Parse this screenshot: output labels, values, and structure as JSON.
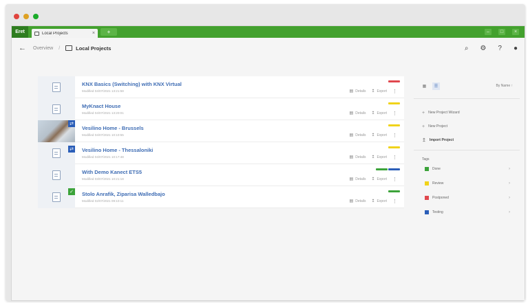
{
  "window": {
    "traffic_lights": [
      "#e0443e",
      "#dea123",
      "#1aab29"
    ]
  },
  "titlebar": {
    "brand": "Eret",
    "tab_label": "Local Projects",
    "tab_close": "×",
    "new_tab": "+",
    "controls": [
      "–",
      "□",
      "×"
    ]
  },
  "navbar": {
    "back": "←",
    "crumb_overview": "Overview",
    "crumb_sep": "/",
    "current": "Local Projects",
    "actions": [
      "⌕",
      "⚙",
      "?",
      "●"
    ]
  },
  "projects": [
    {
      "name": "KNX Basics (Switching) with KNX Virtual",
      "modified": "Modified 04/07/2021 13:21:58",
      "detail": "Details",
      "export": "Export",
      "tags": [
        "#e0484e"
      ],
      "thumb": "doc",
      "badge": null
    },
    {
      "name": "MyKnact House",
      "modified": "Modified 04/07/2021 13:20:01",
      "detail": "Details",
      "export": "Export",
      "tags": [
        "#f0d31a"
      ],
      "thumb": "building",
      "badge": null
    },
    {
      "name": "Vesilino Home - Brussels",
      "modified": "Modified 04/07/2021 10:10:55",
      "detail": "Details",
      "export": "Export",
      "tags": [
        "#f0d31a"
      ],
      "thumb": "photo",
      "badge": "blue"
    },
    {
      "name": "Vesilino Home - Thessaloniki",
      "modified": "Modified 04/07/2021 10:17:48",
      "detail": "Details",
      "export": "Export",
      "tags": [
        "#f0d31a"
      ],
      "thumb": "doc",
      "badge": "blue-low"
    },
    {
      "name": "With Demo Kanect ETS5",
      "modified": "Modified 03/07/2021 10:21:18",
      "detail": "Details",
      "export": "Export",
      "tags": [
        "#3ca33a",
        "#2b5eb8"
      ],
      "thumb": "doc",
      "badge": null
    },
    {
      "name": "Stolo Anrafik, Ziparisa Walledbajo",
      "modified": "Modified 02/07/2021 09:10:11",
      "detail": "Details",
      "export": "Export",
      "tags": [
        "#3ca33a"
      ],
      "thumb": "doc",
      "badge": "green"
    }
  ],
  "sidebar": {
    "sort_label": "By Name",
    "sort_arrow": "↑",
    "links": [
      "New Project Wizard",
      "New Project",
      "Import Project"
    ],
    "tags_title": "Tags",
    "tags": [
      {
        "label": "Done",
        "color": "#3ca33a"
      },
      {
        "label": "Review",
        "color": "#f0d31a"
      },
      {
        "label": "Postponed",
        "color": "#e0484e"
      },
      {
        "label": "Testing",
        "color": "#2b5eb8"
      }
    ]
  }
}
